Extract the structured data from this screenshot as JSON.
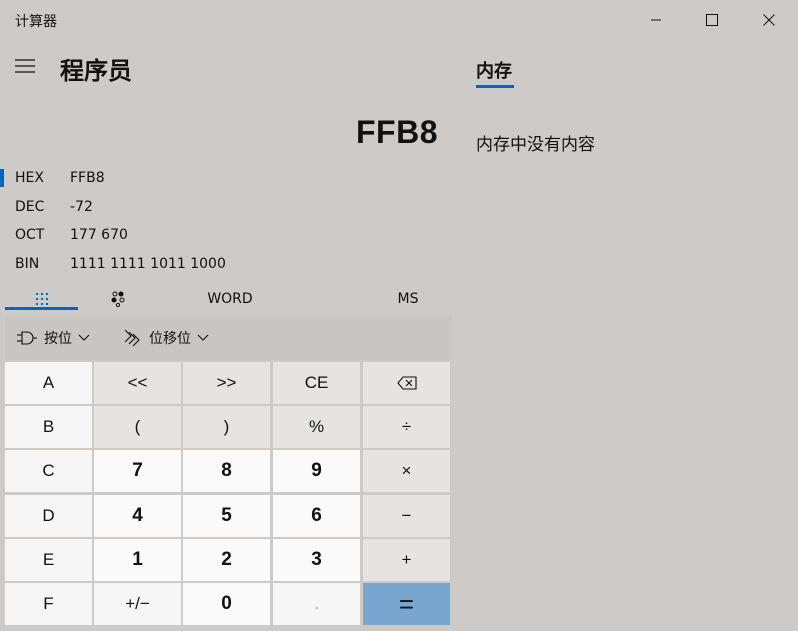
{
  "window": {
    "title": "计算器"
  },
  "header": {
    "mode": "程序员"
  },
  "display": {
    "value": "FFB8"
  },
  "radix": [
    {
      "label": "HEX",
      "value": "FFB8",
      "active": true
    },
    {
      "label": "DEC",
      "value": "-72",
      "active": false
    },
    {
      "label": "OCT",
      "value": "177 670",
      "active": false
    },
    {
      "label": "BIN",
      "value": "1111 1111 1011 1000",
      "active": false
    }
  ],
  "keyboard_tabs": {
    "word_size": "WORD",
    "memory_store": "MS"
  },
  "bitbar": {
    "bitwise": "按位",
    "bitshift": "位移位"
  },
  "keys": {
    "r0": [
      "A",
      "<<",
      ">>",
      "CE",
      ""
    ],
    "r1": [
      "B",
      "(",
      ")",
      "%",
      "÷"
    ],
    "r2": [
      "C",
      "7",
      "8",
      "9",
      "×"
    ],
    "r3": [
      "D",
      "4",
      "5",
      "6",
      "−"
    ],
    "r4": [
      "E",
      "1",
      "2",
      "3",
      "+"
    ],
    "r5": [
      "F",
      "+/−",
      "0",
      ".",
      "="
    ]
  },
  "memory": {
    "title": "内存",
    "empty_text": "内存中没有内容"
  },
  "colors": {
    "background": "#cdcac7",
    "accent": "#0067c0",
    "equals": "#78a6cf"
  }
}
